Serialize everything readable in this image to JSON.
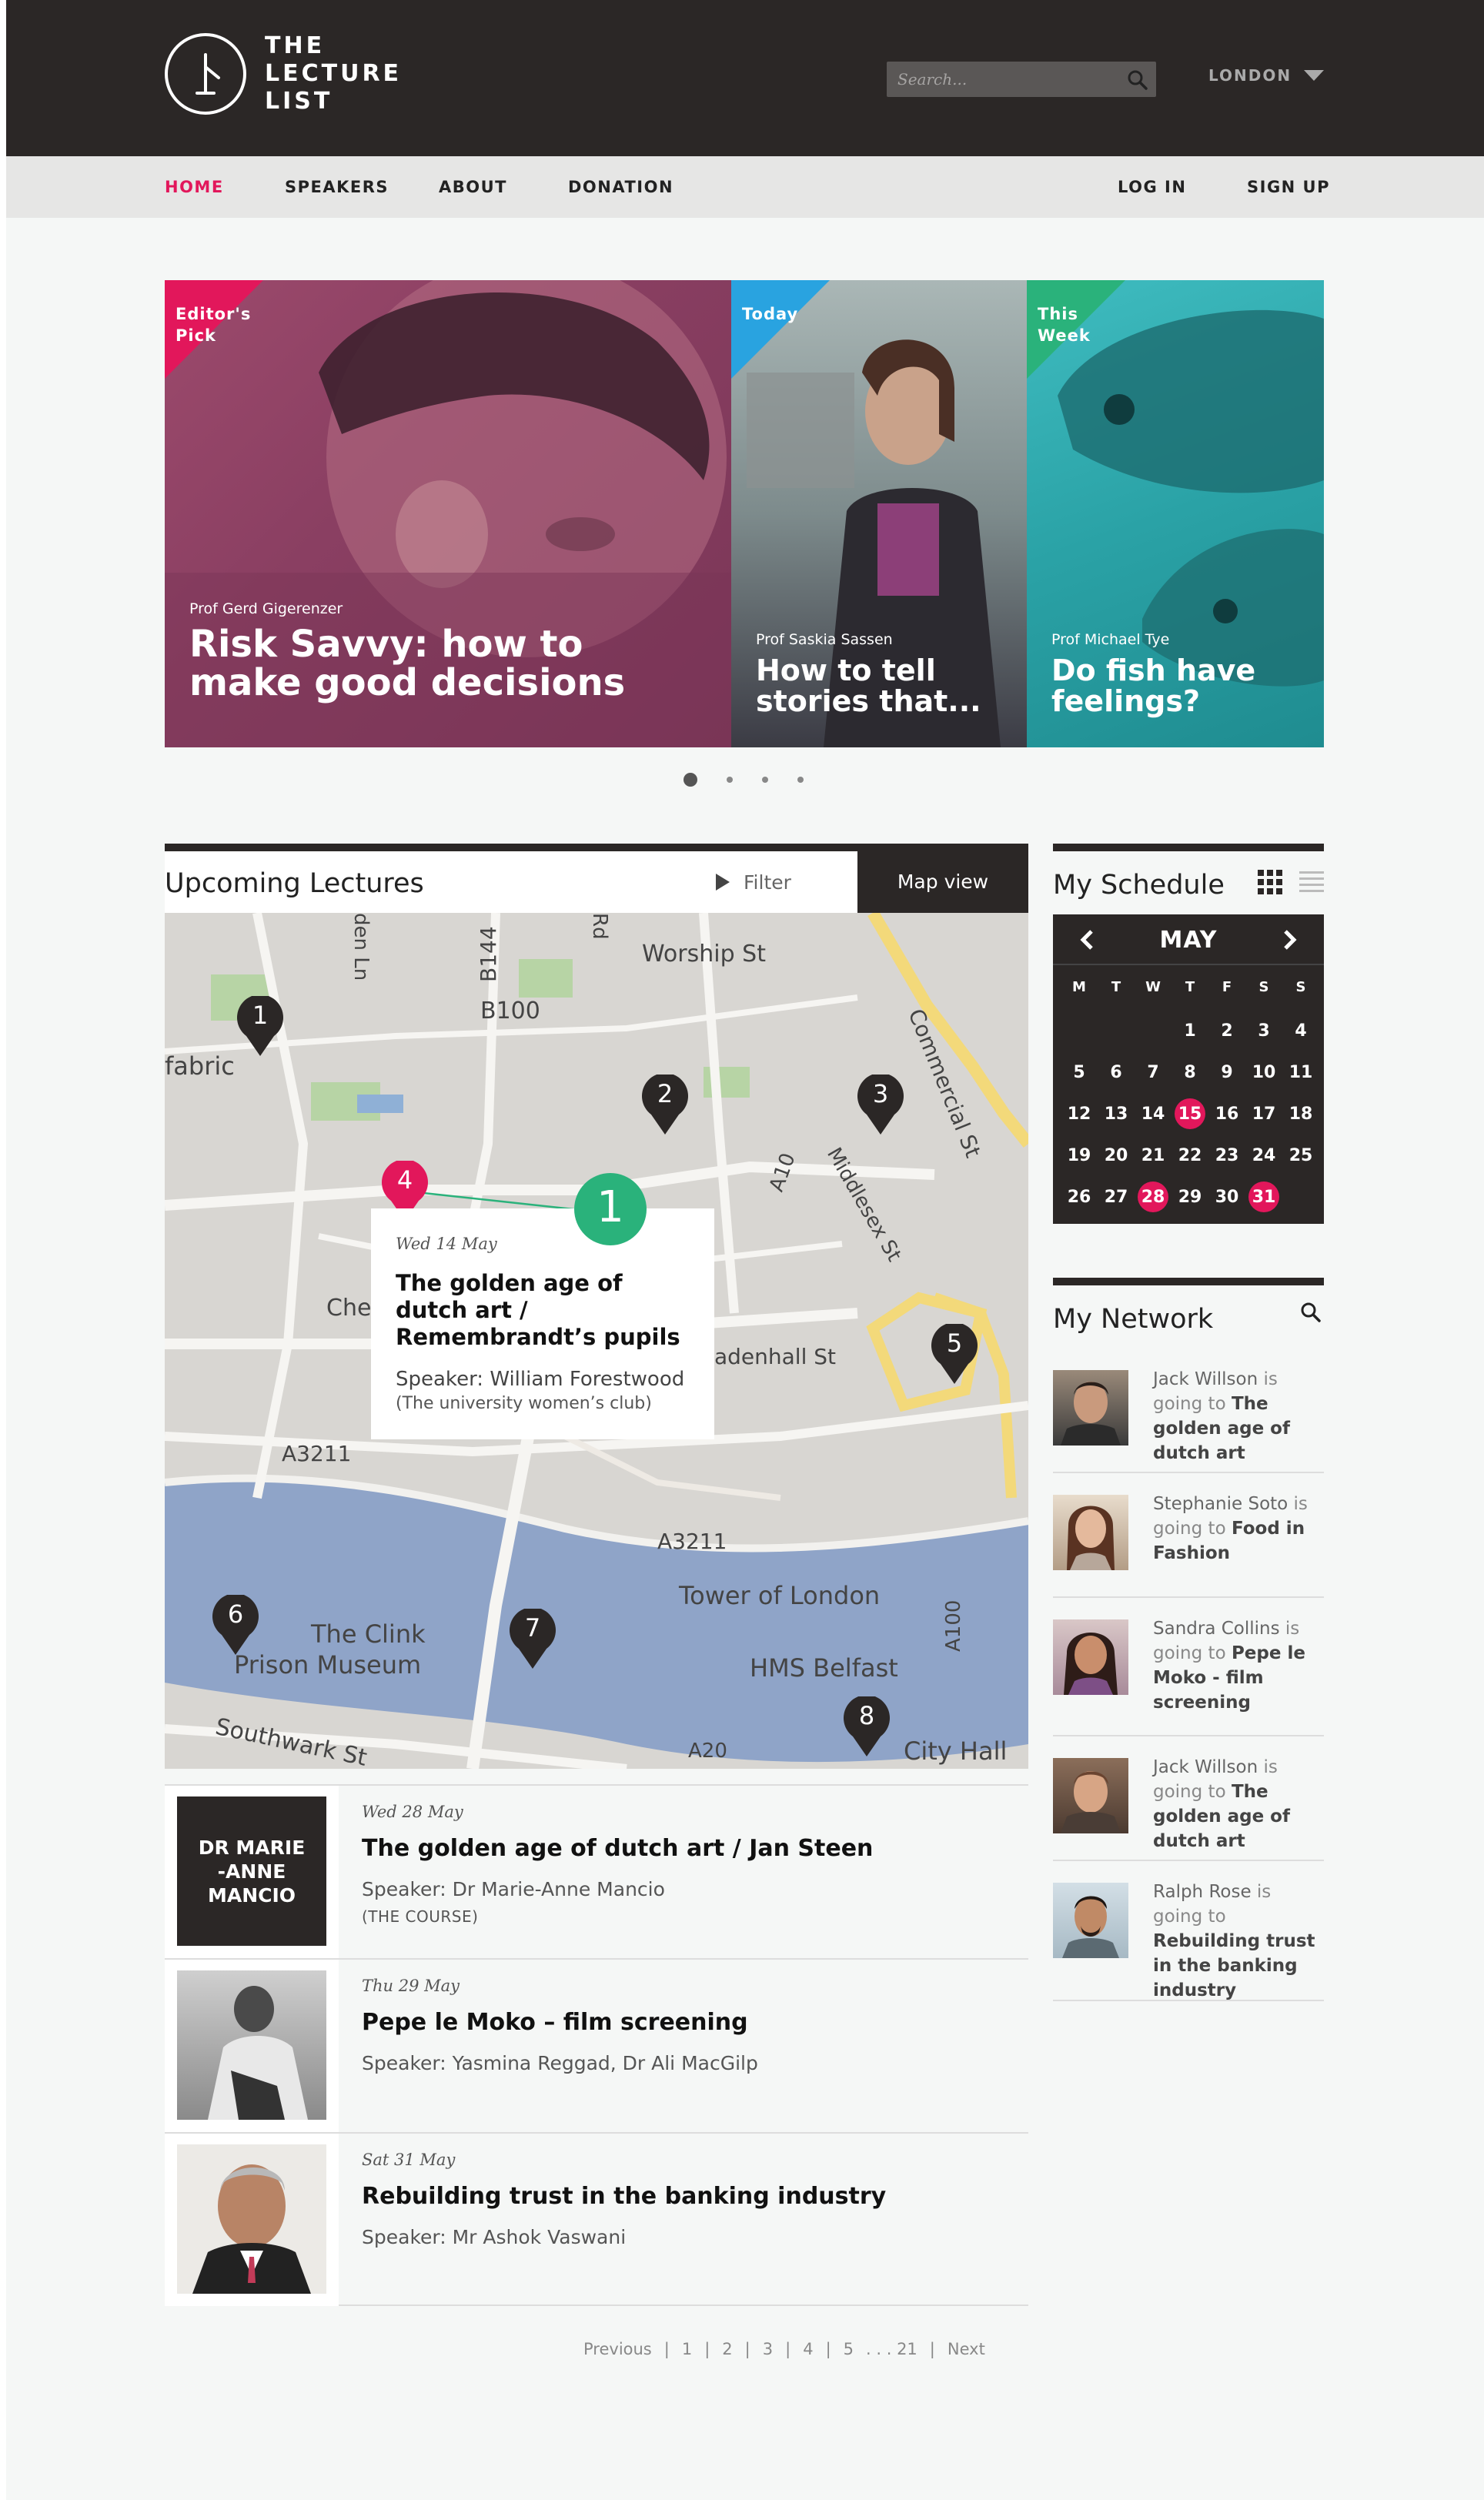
{
  "brand": {
    "name": "THE\nLECTURE\nLIST"
  },
  "search": {
    "placeholder": "Search..."
  },
  "location": {
    "city": "LONDON"
  },
  "nav": {
    "home": "HOME",
    "speakers": "SPEAKERS",
    "about": "ABOUT",
    "donation": "DONATION",
    "login": "LOG IN",
    "signup": "SIGN UP"
  },
  "colors": {
    "accent": "#e2175b",
    "today": "#29a3e0",
    "week": "#2ab27b",
    "dark": "#2b2726"
  },
  "hero": {
    "slides": [
      {
        "badge": "Editor's\nPick",
        "speaker": "Prof Gerd Gigerenzer",
        "title": "Risk Savvy: how to make good decisions"
      },
      {
        "badge": "Today",
        "speaker": "Prof Saskia Sassen",
        "title": "How to tell stories that..."
      },
      {
        "badge": "This\nWeek",
        "speaker": "Prof Michael Tye",
        "title": "Do fish have feelings?"
      }
    ]
  },
  "upcoming": {
    "title": "Upcoming Lectures",
    "filter": "Filter",
    "map_view": "Map view"
  },
  "map": {
    "labels": [
      "Worship St",
      "B144",
      "B100",
      "fabric",
      "Commercial St",
      "A10",
      "Middlesex St",
      "Che",
      "A3211",
      "adenhall St",
      "A3211",
      "Tower of London",
      "A100",
      "The Clink",
      "Prison Museum",
      "HMS Belfast",
      "Southwark St",
      "A20",
      "City Hall",
      "den Ln",
      "Rd"
    ],
    "pins": [
      "1",
      "2",
      "3",
      "4",
      "5",
      "6",
      "7",
      "8"
    ],
    "popup": {
      "pin": "1",
      "date": "Wed 14 May",
      "title": "The golden age of dutch art / Remembrandt’s pupils",
      "speaker": "Speaker: William Forestwood",
      "venue": "(The university women’s club)"
    }
  },
  "lectures": [
    {
      "thumb_text": "DR MARIE -ANNE MANCIO",
      "date": "Wed 28 May",
      "title": "The golden age of dutch art / Jan Steen",
      "speaker": "Speaker: Dr Marie-Anne Mancio",
      "venue": "(THE COURSE)"
    },
    {
      "date": "Thu 29 May",
      "title": "Pepe le Moko – film screening",
      "speaker": "Speaker: Yasmina Reggad, Dr Ali MacGilp"
    },
    {
      "date": "Sat 31 May",
      "title": "Rebuilding trust in the banking industry",
      "speaker": "Speaker: Mr Ashok Vaswani"
    }
  ],
  "pagination": {
    "previous": "Previous",
    "pages": [
      "1",
      "2",
      "3",
      "4",
      "5"
    ],
    "ellipsis": ". . . 21",
    "next": "Next",
    "sep": "|"
  },
  "schedule": {
    "title": "My Schedule",
    "month": "MAY",
    "weekdays": [
      "M",
      "T",
      "W",
      "T",
      "F",
      "S",
      "S"
    ],
    "weeks": [
      [
        "",
        "",
        "",
        "1",
        "2",
        "3",
        "4"
      ],
      [
        "5",
        "6",
        "7",
        "8",
        "9",
        "10",
        "11"
      ],
      [
        "12",
        "13",
        "14",
        "15",
        "16",
        "17",
        "18"
      ],
      [
        "19",
        "20",
        "21",
        "22",
        "23",
        "24",
        "25"
      ],
      [
        "26",
        "27",
        "28",
        "29",
        "30",
        "31",
        ""
      ]
    ],
    "highlighted": [
      "15",
      "28",
      "31"
    ]
  },
  "network": {
    "title": "My Network",
    "items": [
      {
        "name": "Jack Willson",
        "verb": "is going to",
        "event": "The golden age of dutch art"
      },
      {
        "name": "Stephanie Soto",
        "verb": "is going to",
        "event": "Food in Fashion"
      },
      {
        "name": "Sandra Collins",
        "verb": "is going to",
        "event": "Pepe le Moko - film screening"
      },
      {
        "name": "Jack Willson",
        "verb": "is going to",
        "event": "The golden age of dutch art"
      },
      {
        "name": "Ralph Rose",
        "verb": "is going to",
        "event": "Rebuilding trust in the banking industry"
      }
    ]
  }
}
